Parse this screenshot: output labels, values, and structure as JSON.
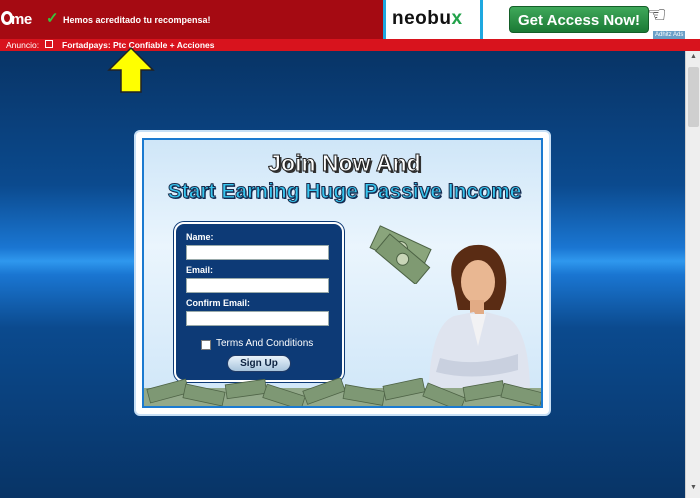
{
  "topbar": {
    "logo_text": "me",
    "success_message": "Hemos acreditado tu recompensa!",
    "neobux_text_main": "neobu",
    "neobux_text_x": "x",
    "access_button": "Get Access Now!",
    "adhitz_label": "Adhitz Ads"
  },
  "subbar": {
    "label": "Anuncio:",
    "link_text": "Fortadpays: Ptc Confiable + Acciones"
  },
  "ad": {
    "headline_1": "Join Now And",
    "headline_2": "Start Earning Huge Passive Income",
    "form": {
      "name_label": "Name:",
      "email_label": "Email:",
      "confirm_label": "Confirm Email:",
      "terms_label": "Terms And Conditions",
      "signup_button": "Sign Up"
    }
  },
  "colors": {
    "topbar": "#a50a12",
    "subbar": "#d8131d",
    "arrow": "#ffff00",
    "form_bg": "#0d3a76",
    "headline_2": "#37c6f0"
  }
}
